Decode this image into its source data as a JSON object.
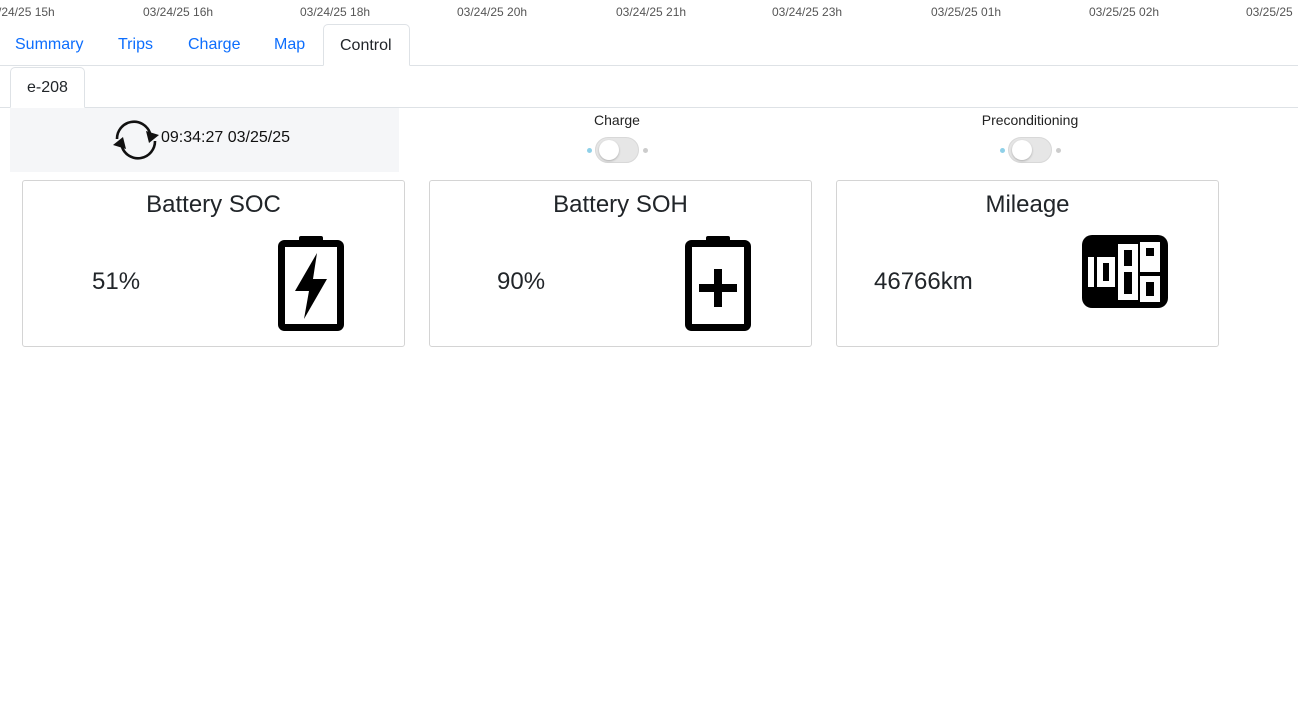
{
  "timeline": {
    "ticks": [
      "/24/25 15h",
      "03/24/25 16h",
      "03/24/25 18h",
      "03/24/25 20h",
      "03/24/25 21h",
      "03/24/25 23h",
      "03/25/25 01h",
      "03/25/25 02h",
      "03/25/25"
    ]
  },
  "nav": {
    "tabs": [
      {
        "label": "Summary"
      },
      {
        "label": "Trips"
      },
      {
        "label": "Charge"
      },
      {
        "label": "Map"
      },
      {
        "label": "Control"
      }
    ],
    "active": "Control"
  },
  "vehicle": {
    "tab_label": "e-208"
  },
  "refresh": {
    "icon": "refresh-icon",
    "timestamp": "09:34:27 03/25/25"
  },
  "toggles": {
    "charge": {
      "label": "Charge",
      "checked": false
    },
    "preconditioning": {
      "label": "Preconditioning",
      "checked": false
    }
  },
  "cards": {
    "soc": {
      "title": "Battery SOC",
      "value": "51%",
      "icon": "battery-charging-icon"
    },
    "soh": {
      "title": "Battery SOH",
      "value": "90%",
      "icon": "battery-health-icon"
    },
    "mileage": {
      "title": "Mileage",
      "value": "46766km",
      "icon": "odometer-icon"
    }
  },
  "colors": {
    "link": "#0d6efd",
    "toggle_dot": "#8fd0e8",
    "toggle_dot_off": "#cccccc"
  }
}
